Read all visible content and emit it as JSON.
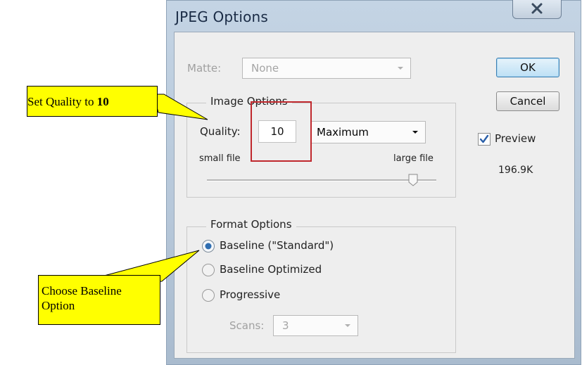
{
  "dialog": {
    "title": "JPEG Options",
    "matte": {
      "label": "Matte:",
      "value": "None",
      "enabled": false
    },
    "image_options": {
      "title": "Image Options",
      "quality_label": "Quality:",
      "quality_value": "10",
      "quality_preset": "Maximum",
      "small_file_label": "small file",
      "large_file_label": "large file",
      "slider_level_fraction": 0.9
    },
    "format_options": {
      "title": "Format Options",
      "options": [
        "Baseline (\"Standard\")",
        "Baseline Optimized",
        "Progressive"
      ],
      "selected": "Baseline (\"Standard\")",
      "scans_label": "Scans:",
      "scans_value": "3",
      "scans_enabled": false
    },
    "buttons": {
      "ok": "OK",
      "cancel": "Cancel"
    },
    "preview": {
      "label": "Preview",
      "checked": true,
      "file_size": "196.9K"
    }
  },
  "annotations": {
    "quality_callout": {
      "prefix": "Set Quality to ",
      "value": "10"
    },
    "baseline_callout": {
      "line1": "Choose Baseline",
      "line2": "Option"
    },
    "highlight_color": "#c0282d",
    "callout_color": "#ffff00"
  },
  "icons": [
    "close-icon",
    "dropdown-arrow-icon",
    "slider-thumb-icon",
    "radio-selected-icon",
    "radio-unselected-icon",
    "checkmark-icon"
  ]
}
